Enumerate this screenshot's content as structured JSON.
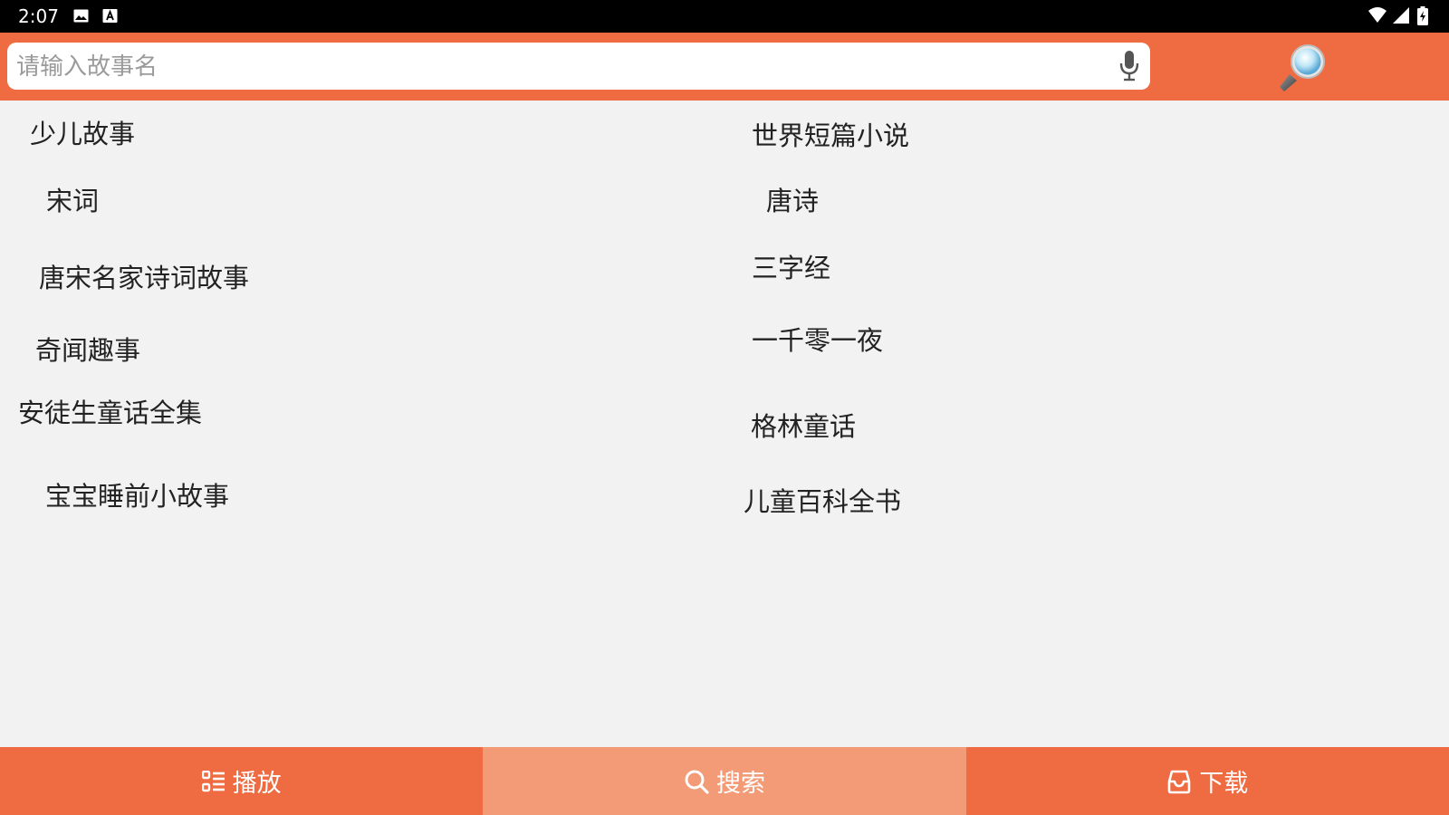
{
  "status_bar": {
    "time": "2:07"
  },
  "search": {
    "placeholder": "请输入故事名",
    "value": ""
  },
  "colors": {
    "header": "#ef6b42",
    "active_tab": "#f39a76",
    "background": "#f2f2f2"
  },
  "categories": {
    "left": [
      "少儿故事",
      "宋词",
      "唐宋名家诗词故事",
      "奇闻趣事",
      "安徒生童话全集",
      "宝宝睡前小故事"
    ],
    "right": [
      "世界短篇小说",
      "唐诗",
      "三字经",
      "一千零一夜",
      "格林童话",
      "儿童百科全书"
    ]
  },
  "bottom_nav": {
    "tabs": [
      {
        "label": "播放",
        "icon": "list-icon",
        "active": false
      },
      {
        "label": "搜索",
        "icon": "search-icon",
        "active": true
      },
      {
        "label": "下载",
        "icon": "inbox-icon",
        "active": false
      }
    ]
  }
}
